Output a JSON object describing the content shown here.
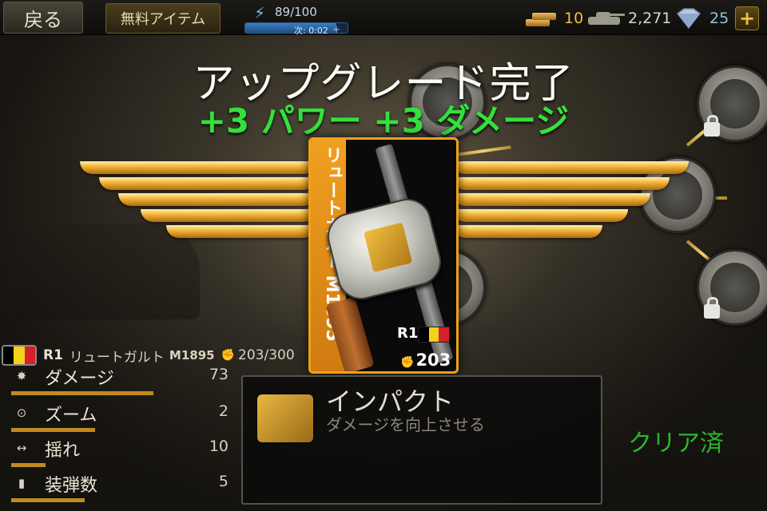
{
  "topbar": {
    "back_label": "戻る",
    "free_items_label": "無料アイテム",
    "energy_count": "89/100",
    "energy_next": "次: 0:02",
    "energy_fraction": 0.89,
    "gold": "10",
    "tanks": "2,271",
    "diamonds": "25",
    "plus_label": "+"
  },
  "banner": {
    "title": "アップグレード完了",
    "subtitle": "+3 パワー +3 ダメージ"
  },
  "card": {
    "name": "リュートガルト M1895",
    "rank": "R1",
    "power": "203",
    "flag_colors": [
      "#000000",
      "#f2d21a",
      "#d8202a"
    ]
  },
  "unit": {
    "rank": "R1",
    "name": "リュートガルト",
    "model": "M1895",
    "power": "203/300"
  },
  "stats": [
    {
      "icon": "explosion-icon",
      "label": "ダメージ",
      "value": "73",
      "fraction": 0.66
    },
    {
      "icon": "crosshair-icon",
      "label": "ズーム",
      "value": "2",
      "fraction": 0.39
    },
    {
      "icon": "sway-arrows-icon",
      "label": "揺れ",
      "value": "10",
      "fraction": 0.16
    },
    {
      "icon": "ammo-icon",
      "label": "装弾数",
      "value": "5",
      "fraction": 0.34
    }
  ],
  "impact": {
    "title": "インパクト",
    "description": "ダメージを向上させる"
  },
  "status": {
    "cleared": "クリア済"
  },
  "colors": {
    "accent_gold": "#f0a018",
    "upgrade_green": "#34e03c",
    "cleared_green": "#2bb62a"
  }
}
